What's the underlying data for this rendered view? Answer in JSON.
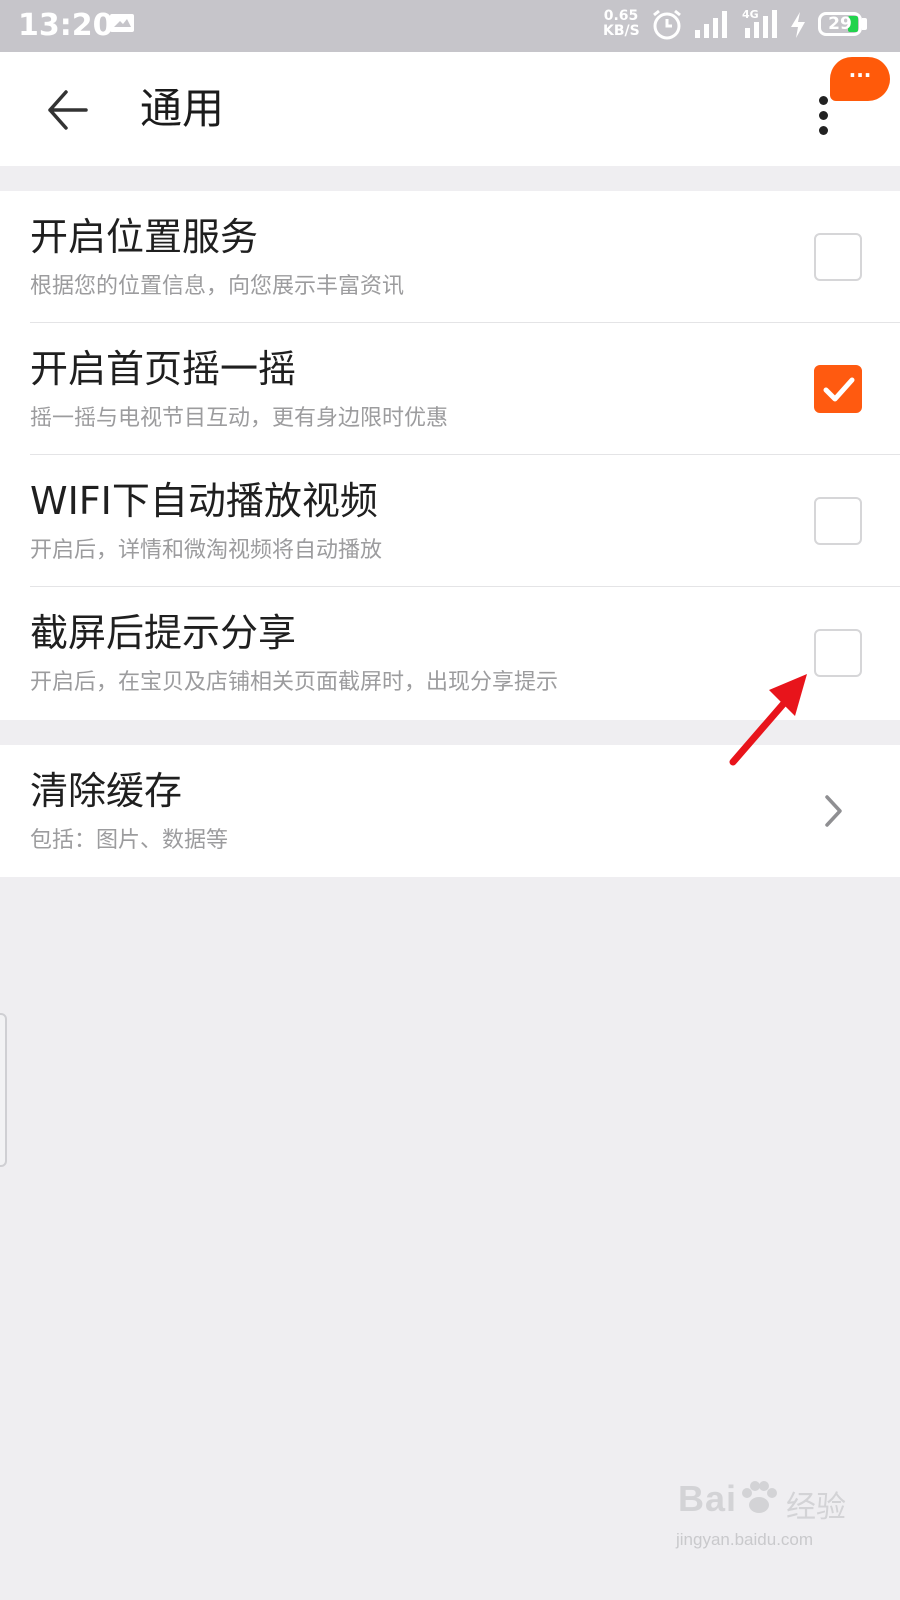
{
  "status_bar": {
    "time": "13:20",
    "net_speed_value": "0.65",
    "net_speed_unit": "KB/S",
    "network_type": "4G",
    "battery": "29",
    "battery_color": "#22d34d"
  },
  "header": {
    "title": "通用",
    "back_icon": "back-arrow-icon",
    "more_icon": "more-vertical-icon",
    "bubble_text": "···"
  },
  "settings": [
    {
      "title": "开启位置服务",
      "subtitle": "根据您的位置信息，向您展示丰富资讯",
      "checked": false
    },
    {
      "title": "开启首页摇一摇",
      "subtitle": "摇一摇与电视节目互动，更有身边限时优惠",
      "checked": true
    },
    {
      "title": "WIFI下自动播放视频",
      "subtitle": "开启后，详情和微淘视频将自动播放",
      "checked": false
    },
    {
      "title": "截屏后提示分享",
      "subtitle": "开启后，在宝贝及店铺相关页面截屏时，出现分享提示",
      "checked": false
    }
  ],
  "clear_cache": {
    "title": "清除缓存",
    "subtitle": "包括：图片、数据等"
  },
  "colors": {
    "accent": "#ff5a10",
    "annotation_arrow": "#e8141b",
    "background": "#efeef1"
  },
  "watermark": {
    "brand": "Bai",
    "brand_cn": "经验",
    "url": "jingyan.baidu.com"
  }
}
